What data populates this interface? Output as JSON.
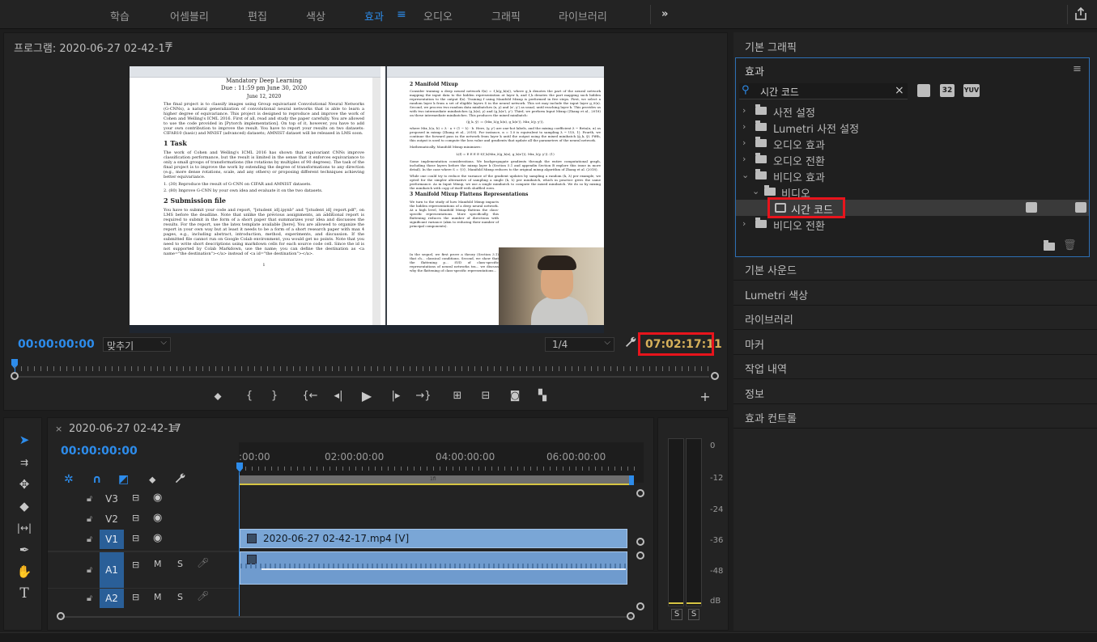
{
  "workspace_tabs": [
    "학습",
    "어셈블리",
    "편집",
    "색상",
    "효과",
    "오디오",
    "그래픽",
    "라이브러리"
  ],
  "workspace_active": "효과",
  "workspace_more": "»",
  "program": {
    "title": "프로그램: 2020-06-27 02-42-17",
    "timecode_current": "00:00:00:00",
    "fit_label": "맞추기",
    "resolution": "1/4",
    "timecode_duration": "07:02:17:11"
  },
  "video_content": {
    "left_doc": {
      "title_line": "Mandatory Deep Learning",
      "due": "Due : 11:59 pm June 30, 2020",
      "date": "June 12, 2020",
      "intro": "The final project is to classify images using Group equivariant Convolutional Neural Networks (G-CNNs), a natural generalization of convolutional neural networks that is able to learn a higher degree of equivariance. This project is designed to reproduce and improve the work of Cohen and Welling's ICML 2016. First of all, read and study the paper carefully. You are allowed to use the code provided in [Pytorch implementation]. On top of it, however, you have to add your own contribution to improve the result. You have to report your results on two datasets: CIFAR10 (basic) and MNIST (advanced) datasets; AMNIST dataset will be released in LMS soon.",
      "h1": "1   Task",
      "task": "The work of Cohen and Welling's ICML 2016 has shown that equivariant CNNs improve classification performance, but the result is limited in the sense that it enforces equivariance to only a small groups of transformations (the rotations by multiples of 90 degrees). The task of the final project is to improve the work by extending the degree of transformations to any direction (e.g., more dense rotations, scale, and any others) or proposing different techniques achieving better equivariance.",
      "item1": "1. (30) Reproduce the result of G-CNN on CIFAR and AMNIST datasets.",
      "item2": "2. (80) Improve G-CNN by your own idea and evaluate it on the two datasets.",
      "h2": "2   Submission file",
      "submission": "You have to submit your code and report, \"[student_id].ipynb\" and \"[student_id]_report.pdf\", on LMS before the deadline. Note that unlike the previous assignments, an additional report is required to submit in the form of a short paper that summarizes your idea and discusses the results. For the report, use the latex template available [here]. You are allowed to organize the report in your own way but at least it needs to be a form of a short research paper with max 4 pages, e.g., including abstract, introduction, method, experiments, and discussion. If the submitted file cannot run on Google Colab environment, you would get no points. Note that you need to write short descriptions using markdown cells for each source code cell. Since the id is not supported by Colab Markdown, use the name; you can define the destination as <a name=\"the destination\"></a> instead of <a id=\"the destination\"></a>.",
      "page": "1"
    },
    "right_doc": {
      "h2": "2   Manifold Mixup",
      "p1": "Consider training a deep neural network f(x) = f_k(g_k(x)), where g_k denotes the part of the neural network mapping the input data to the hidden representation at layer k, and f_k denotes the part mapping such hidden representation to the output f(x). Training f using Manifold Mixup is performed in five steps. First, we select a random layer k from a set of eligible layers S in the neural network. This set may include the input layer g_0(x). Second, we process two random data minibatches (x, y) and (x', y') as usual, until reaching layer k. This provides us with two intermediate minibatches (g_k(x), y) and (g_k(x'), y'). Third, we perform Input Mixup (Zhang et al., 2018) on these intermediate minibatches. This produces the mixed minibatch:",
      "eq1": "(g̃_k, ỹ) := (Mix_λ(g_k(x), g_k(x')), Mix_λ(y, y')),",
      "p2": "where Mix_λ(a, b) = λ · a + (1 − λ) · b. Here, (y, y') are one-hot labels, and the mixing coefficient λ ~ Beta(α, α) as proposed in mixup (Zhang et al., 2018). For instance, α = 1.0 is equivalent to sampling λ ~ U(0, 1). Fourth, we continue the forward pass in the network from layer k until the output using the mixed minibatch (g̃_k, ỹ). Fifth, this output is used to compute the loss value and gradients that update all the parameters of the neural network.",
      "p3": "Mathematically, Manifold Mixup minimizes:",
      "eq2": "L(f) = E E E E ℓ(f_k(Mix_λ(g_k(x), g_k(x'))), Mix_λ(y, y')).   (1)",
      "p4": "Some implementation considerations. We backpropagate gradients through the entire computational graph, including those layers before the mixup layer k (Section 5.1 and appendix Section B explore this issue in more detail). In the case where S = {0}, Manifold Mixup reduces to the original mixup algorithm of Zhang et al. (2018).",
      "p5": "While one could try to reduce the variance of the gradient updates by sampling a random (k, λ) per example, we opted for the simpler alternative of sampling a single (k, λ) per minibatch, which in practice gives the same performance. As in Input Mixup, we use a single minibatch to compute the mixed minibatch. We do so by mixing the minibatch with copy of itself with shuffled rows.",
      "h3": "3   Manifold Mixup Flattens Representations",
      "p6": "We turn to the study of how Manifold Mixup impacts the hidden representations of a deep neural network. At a high level, Manifold Mixup flattens the class-specific representations. More specifically, this flattening reduces the number of directions with significant variance (akin to reducing their number of principal components).",
      "p7": "In the sequel, we first prove a theory (Section 3.1) that ch... classical conditions. Second, we show that the flattening p... SVD of class-specific representations of neural networks tra... we discuss why the flattening of class-specific representations..."
    }
  },
  "timeline": {
    "sequence_name": "2020-06-27 02-42-17",
    "timecode": "00:00:00:00",
    "ruler_labels": [
      ":00:00",
      "02:00:00:00",
      "04:00:00:00",
      "06:00:00:00"
    ],
    "video_tracks": [
      "V3",
      "V2",
      "V1"
    ],
    "audio_tracks": [
      "A1",
      "A2"
    ],
    "mute_label": "M",
    "solo_label": "S",
    "video_clip_label": "2020-06-27 02-42-17.mp4 [V]",
    "work_area_label": "1fi"
  },
  "meter": {
    "db_labels": [
      "0",
      "-12",
      "-24",
      "-36",
      "-48",
      "dB"
    ],
    "solo_buttons": [
      "S",
      "S"
    ]
  },
  "right_panel": {
    "sections_top": [
      "기본 그래픽"
    ],
    "effects_title": "효과",
    "search_value": "시간 코드",
    "preset_icons": [
      "32",
      "YUV"
    ],
    "tree": [
      {
        "label": "사전 설정",
        "level": 0,
        "expanded": false
      },
      {
        "label": "Lumetri 사전 설정",
        "level": 0,
        "expanded": false
      },
      {
        "label": "오디오 효과",
        "level": 0,
        "expanded": false
      },
      {
        "label": "오디오 전환",
        "level": 0,
        "expanded": false
      },
      {
        "label": "비디오 효과",
        "level": 0,
        "expanded": true
      },
      {
        "label": "비디오",
        "level": 1,
        "expanded": true
      },
      {
        "label": "시간 코드",
        "level": 2,
        "expanded": false
      },
      {
        "label": "비디오 전환",
        "level": 0,
        "expanded": false
      }
    ],
    "sections_bottom": [
      "기본 사운드",
      "Lumetri 색상",
      "라이브러리",
      "마커",
      "작업 내역",
      "정보",
      "효과 컨트롤"
    ]
  }
}
